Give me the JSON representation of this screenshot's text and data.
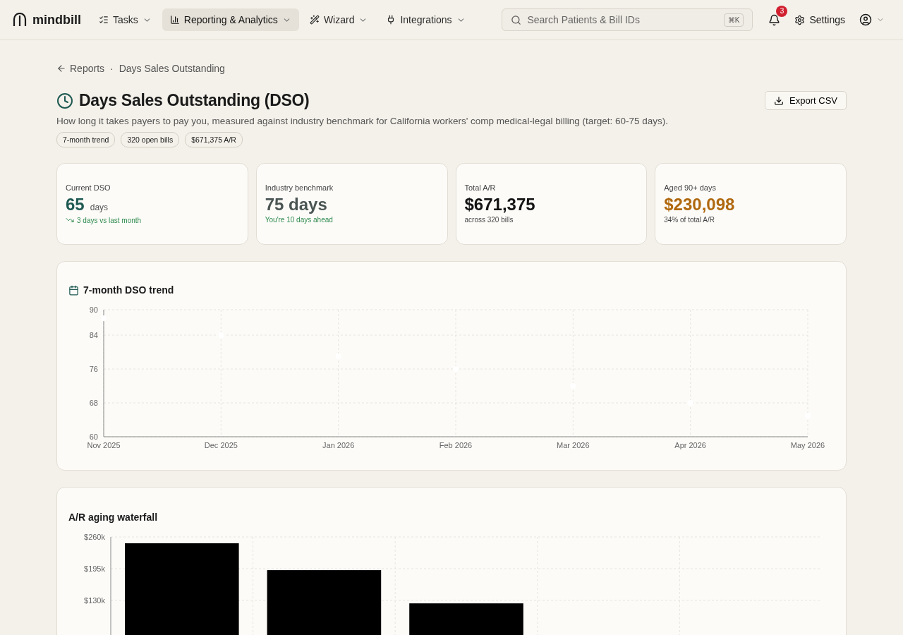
{
  "nav": {
    "logo": "mindbill",
    "menus": [
      {
        "label": "Tasks",
        "kind": "tasks",
        "selected": false
      },
      {
        "label": "Reporting & Analytics",
        "kind": "chart",
        "selected": true
      },
      {
        "label": "Wizard",
        "kind": "wand",
        "selected": false
      },
      {
        "label": "Integrations",
        "kind": "plug",
        "selected": false
      }
    ],
    "search": {
      "placeholder": "Search Patients & Bill IDs",
      "shortcut": "⌘K"
    },
    "notifications": "3",
    "settings": "Settings"
  },
  "breadcrumb": {
    "back": "Reports",
    "separator": "·",
    "current": "Days Sales Outstanding"
  },
  "header": {
    "title": "Days Sales Outstanding (DSO)",
    "export": "Export CSV",
    "subtitle": "How long it takes payers to pay you, measured against industry benchmark for California workers' comp medical-legal billing (target: 60-75 days).",
    "tags": [
      "7-month trend",
      "320 open bills",
      "$671,375 A/R"
    ]
  },
  "stats": [
    {
      "label": "Current DSO",
      "value": "65",
      "unit": "days",
      "note": "3 days vs last month",
      "kind": "trend",
      "color": "#1f5a52"
    },
    {
      "label": "Industry benchmark",
      "value": "75 days",
      "note": "You're 10 days ahead",
      "kind": "good",
      "color": "#4a5553"
    },
    {
      "label": "Total A/R",
      "value": "$671,375",
      "note": "across 320 bills",
      "kind": "plain",
      "color": "#141414"
    },
    {
      "label": "Aged 90+ days",
      "value": "$230,098",
      "note": "34% of total A/R",
      "kind": "plain",
      "color": "#b0680e"
    }
  ],
  "trend": {
    "title": "7-month DSO trend",
    "chart_data": {
      "type": "scatter",
      "categories": [
        "Nov 2025",
        "Dec 2025",
        "Jan 2026",
        "Feb 2026",
        "Mar 2026",
        "Apr 2026",
        "May 2026"
      ],
      "series": [
        {
          "color": "#ffffff",
          "values": [
            88,
            84,
            79,
            76,
            72,
            68,
            65
          ]
        }
      ],
      "ylim": [
        60,
        90
      ],
      "yticks": [
        60,
        68,
        76,
        84,
        90
      ],
      "grid": true
    }
  },
  "waterfall": {
    "title": "A/R aging waterfall",
    "chart_data": {
      "type": "bar",
      "values": [
        247,
        192,
        124,
        null,
        null
      ],
      "ylim": [
        0,
        260
      ],
      "yticks": [
        {
          "value": 130,
          "label": "$130k"
        },
        {
          "value": 195,
          "label": "$195k"
        },
        {
          "value": 260,
          "label": "$260k"
        }
      ],
      "grid": true
    }
  }
}
